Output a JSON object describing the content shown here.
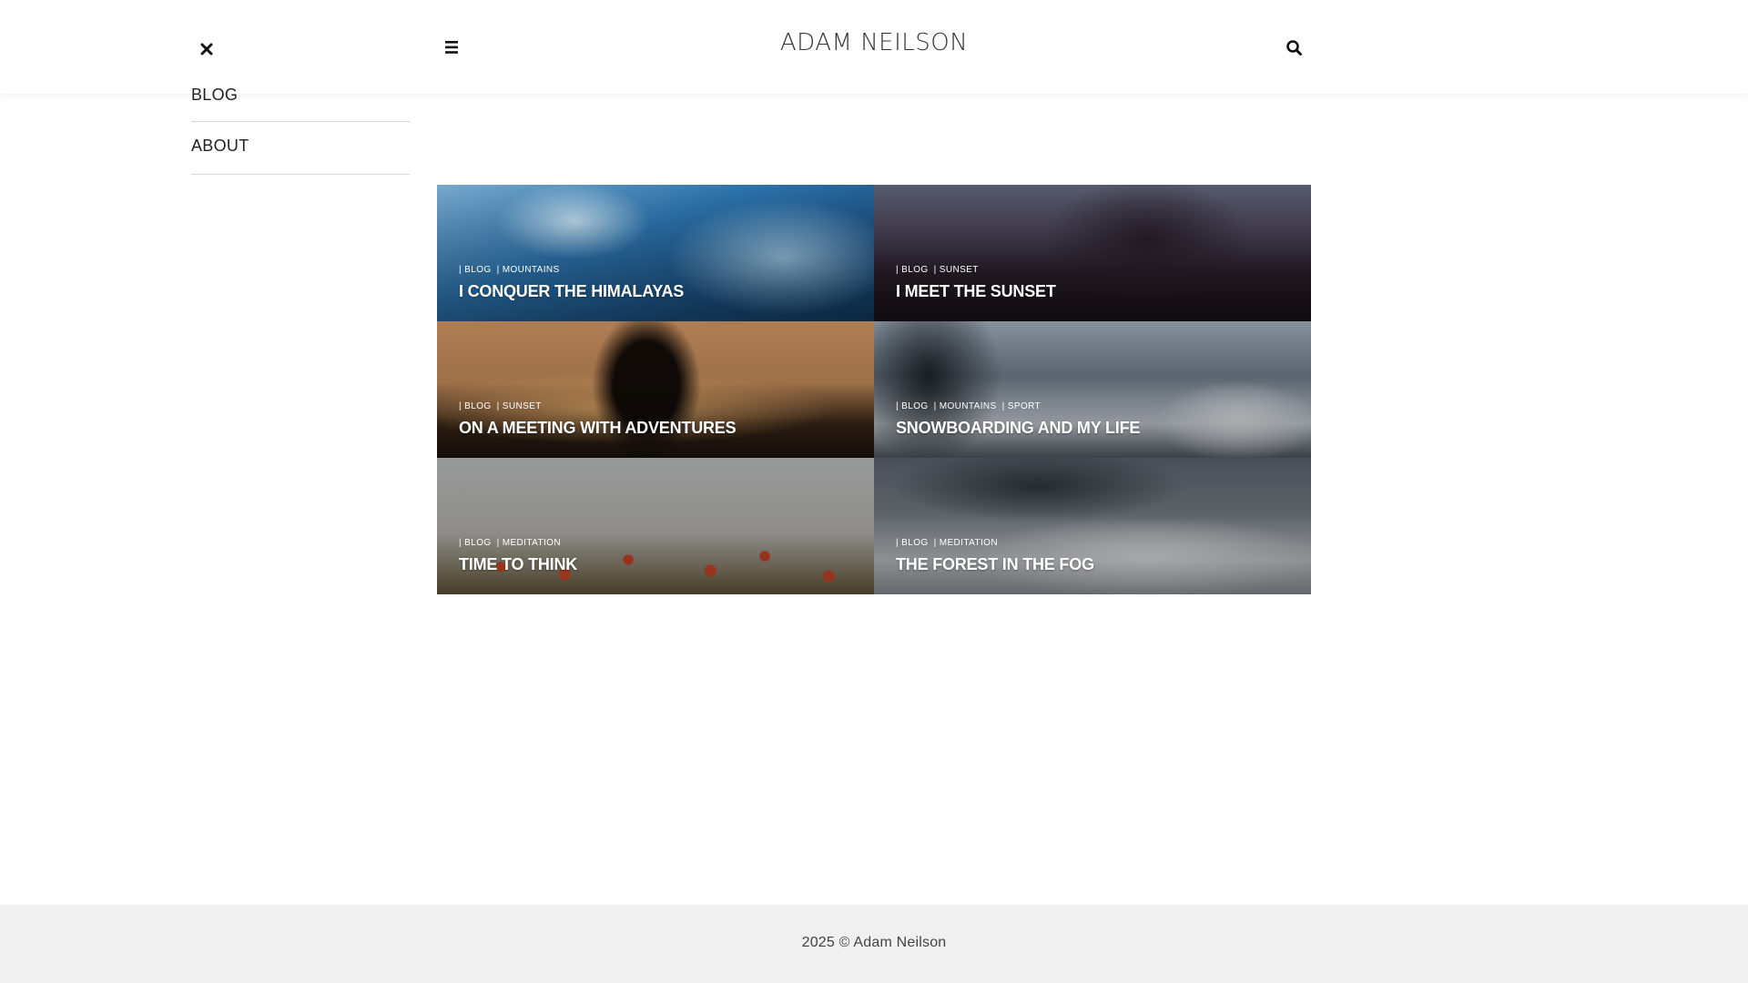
{
  "header": {
    "site_title": "ADAM NEILSON",
    "close_icon": "close-icon",
    "menu_icon": "hamburger-menu-icon",
    "search_icon": "search-icon"
  },
  "side_menu": {
    "items": [
      {
        "label": "BLOG"
      },
      {
        "label": "ABOUT"
      }
    ]
  },
  "posts": [
    {
      "categories": [
        "| BLOG",
        "| MOUNTAINS"
      ],
      "title": "I CONQUER THE HIMALAYAS"
    },
    {
      "categories": [
        "| BLOG",
        "| SUNSET"
      ],
      "title": "I MEET THE SUNSET"
    },
    {
      "categories": [
        "| BLOG",
        "| SUNSET"
      ],
      "title": "ON A MEETING WITH ADVENTURES"
    },
    {
      "categories": [
        "| BLOG",
        "| MOUNTAINS",
        "| SPORT"
      ],
      "title": "SNOWBOARDING AND MY LIFE"
    },
    {
      "categories": [
        "| BLOG",
        "| MEDITATION"
      ],
      "title": "TIME TO THINK"
    },
    {
      "categories": [
        "| BLOG",
        "| MEDITATION"
      ],
      "title": "THE FOREST IN THE FOG"
    }
  ],
  "footer": {
    "text": "2025 © Adam Neilson"
  },
  "colors": {
    "footer_bg": "#f0f0f0",
    "header_bg": "#ffffff",
    "text": "#222222"
  }
}
